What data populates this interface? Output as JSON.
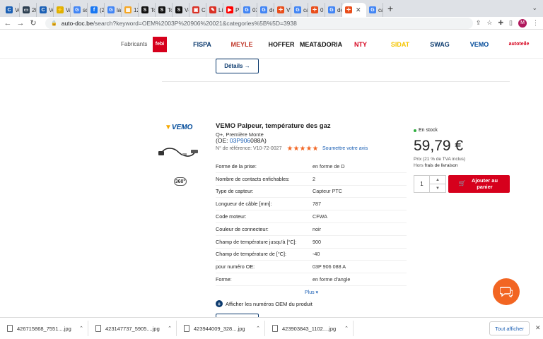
{
  "browser": {
    "tabs": [
      {
        "label": "Vol",
        "fav_color": "#1a5fb4",
        "fav": "C"
      },
      {
        "label": "20",
        "fav_color": "#2c3e50",
        "fav": "▭"
      },
      {
        "label": "Vol",
        "fav_color": "#1a5fb4",
        "fav": "C"
      },
      {
        "label": "Var",
        "fav_color": "#e0b000",
        "fav": "⚡"
      },
      {
        "label": "sch",
        "fav_color": "#4285f4",
        "fav": "G"
      },
      {
        "label": "(2)",
        "fav_color": "#1877f2",
        "fav": "f"
      },
      {
        "label": "lan",
        "fav_color": "#4285f4",
        "fav": "G"
      },
      {
        "label": "12p",
        "fav_color": "#f5a623",
        "fav": "▦"
      },
      {
        "label": "Tou",
        "fav_color": "#111111",
        "fav": "S"
      },
      {
        "label": "Tou",
        "fav_color": "#111111",
        "fav": "S"
      },
      {
        "label": "Vêt",
        "fav_color": "#111111",
        "fav": "S"
      },
      {
        "label": "Co",
        "fav_color": "#d93025",
        "fav": "▣"
      },
      {
        "label": "Lis",
        "fav_color": "#d93025",
        "fav": "✎"
      },
      {
        "label": "PR",
        "fav_color": "#ff0000",
        "fav": "▶"
      },
      {
        "label": "03l",
        "fav_color": "#4285f4",
        "fav": "G"
      },
      {
        "label": "dél",
        "fav_color": "#4285f4",
        "fav": "G"
      },
      {
        "label": "VTe",
        "fav_color": "#e94e1b",
        "fav": "✛"
      },
      {
        "label": "cap",
        "fav_color": "#4285f4",
        "fav": "G"
      },
      {
        "label": "0 2",
        "fav_color": "#e94e1b",
        "fav": "✛"
      },
      {
        "label": "dél",
        "fav_color": "#4285f4",
        "fav": "G"
      }
    ],
    "active_tab": {
      "fav_color": "#e94e1b",
      "fav": "✛"
    },
    "last_tab": {
      "label": "cap",
      "fav_color": "#4285f4",
      "fav": "G"
    },
    "url_host": "auto-doc.be",
    "url_path": "/search?keyword=OEM%2003P%20906%20021&categories%5B%5D=3938"
  },
  "brands": {
    "label": "Fabricants",
    "items": [
      {
        "name": "febi",
        "color": "#d6001c"
      },
      {
        "name": "FISPA",
        "color": "#0b3a6e"
      },
      {
        "name": "MEYLE",
        "color": "#c0392b"
      },
      {
        "name": "HOFFER",
        "color": "#111111"
      },
      {
        "name": "MEAT&DORIA",
        "color": "#111111"
      },
      {
        "name": "NTY",
        "color": "#d6001c"
      },
      {
        "name": "SIDAT",
        "color": "#f5c400"
      },
      {
        "name": "SWAG",
        "color": "#0b3a6e"
      },
      {
        "name": "VEMO",
        "color": "#004a99"
      },
      {
        "name": "autoteile",
        "color": "#d6001c"
      }
    ]
  },
  "details_label": "Détails →",
  "product": {
    "title": "VEMO Palpeur, température des gaz",
    "subtitle": "Q+, Première Monte",
    "oe_prefix": "(OE: ",
    "oe_link": "03P906",
    "oe_rest": "088A)",
    "ref": "N° de référence: V10-72-0027",
    "review_link": "Soumettre votre avis",
    "specs": [
      {
        "k": "Forme de la prise:",
        "v": "en forme de D"
      },
      {
        "k": "Nombre de contacts enfichables:",
        "v": "2"
      },
      {
        "k": "Type de capteur:",
        "v": "Capteur PTC"
      },
      {
        "k": "Longueur de câble [mm]:",
        "v": "787"
      },
      {
        "k": "Code moteur:",
        "v": "CFWA"
      },
      {
        "k": "Couleur de connecteur:",
        "v": "noir"
      },
      {
        "k": "Champ de température jusqu'à [°C]:",
        "v": "900"
      },
      {
        "k": "Champ de température de [°C]:",
        "v": "-40"
      },
      {
        "k": "pour numéro OE:",
        "v": "03P 906 088 A"
      },
      {
        "k": "Forme:",
        "v": "en forme d'angle"
      }
    ],
    "plus_label": "Plus ▾",
    "oe_numbers_link": "Afficher les numéros OEM du produit",
    "stock": "En stock",
    "price": "59,79 €",
    "price_note": "Prix (21 % de TVA inclus)",
    "price_note2_a": "Hors ",
    "price_note2_b": "frais de livraison",
    "qty": "1",
    "add_to_cart": "Ajouter au panier",
    "rating_stars": 5,
    "badge_360": "360°"
  },
  "downloads": {
    "items": [
      "426715868_7551....jpg",
      "423147737_5905....jpg",
      "423944009_328....jpg",
      "423903843_1102....jpg"
    ],
    "show_all": "Tout afficher"
  }
}
